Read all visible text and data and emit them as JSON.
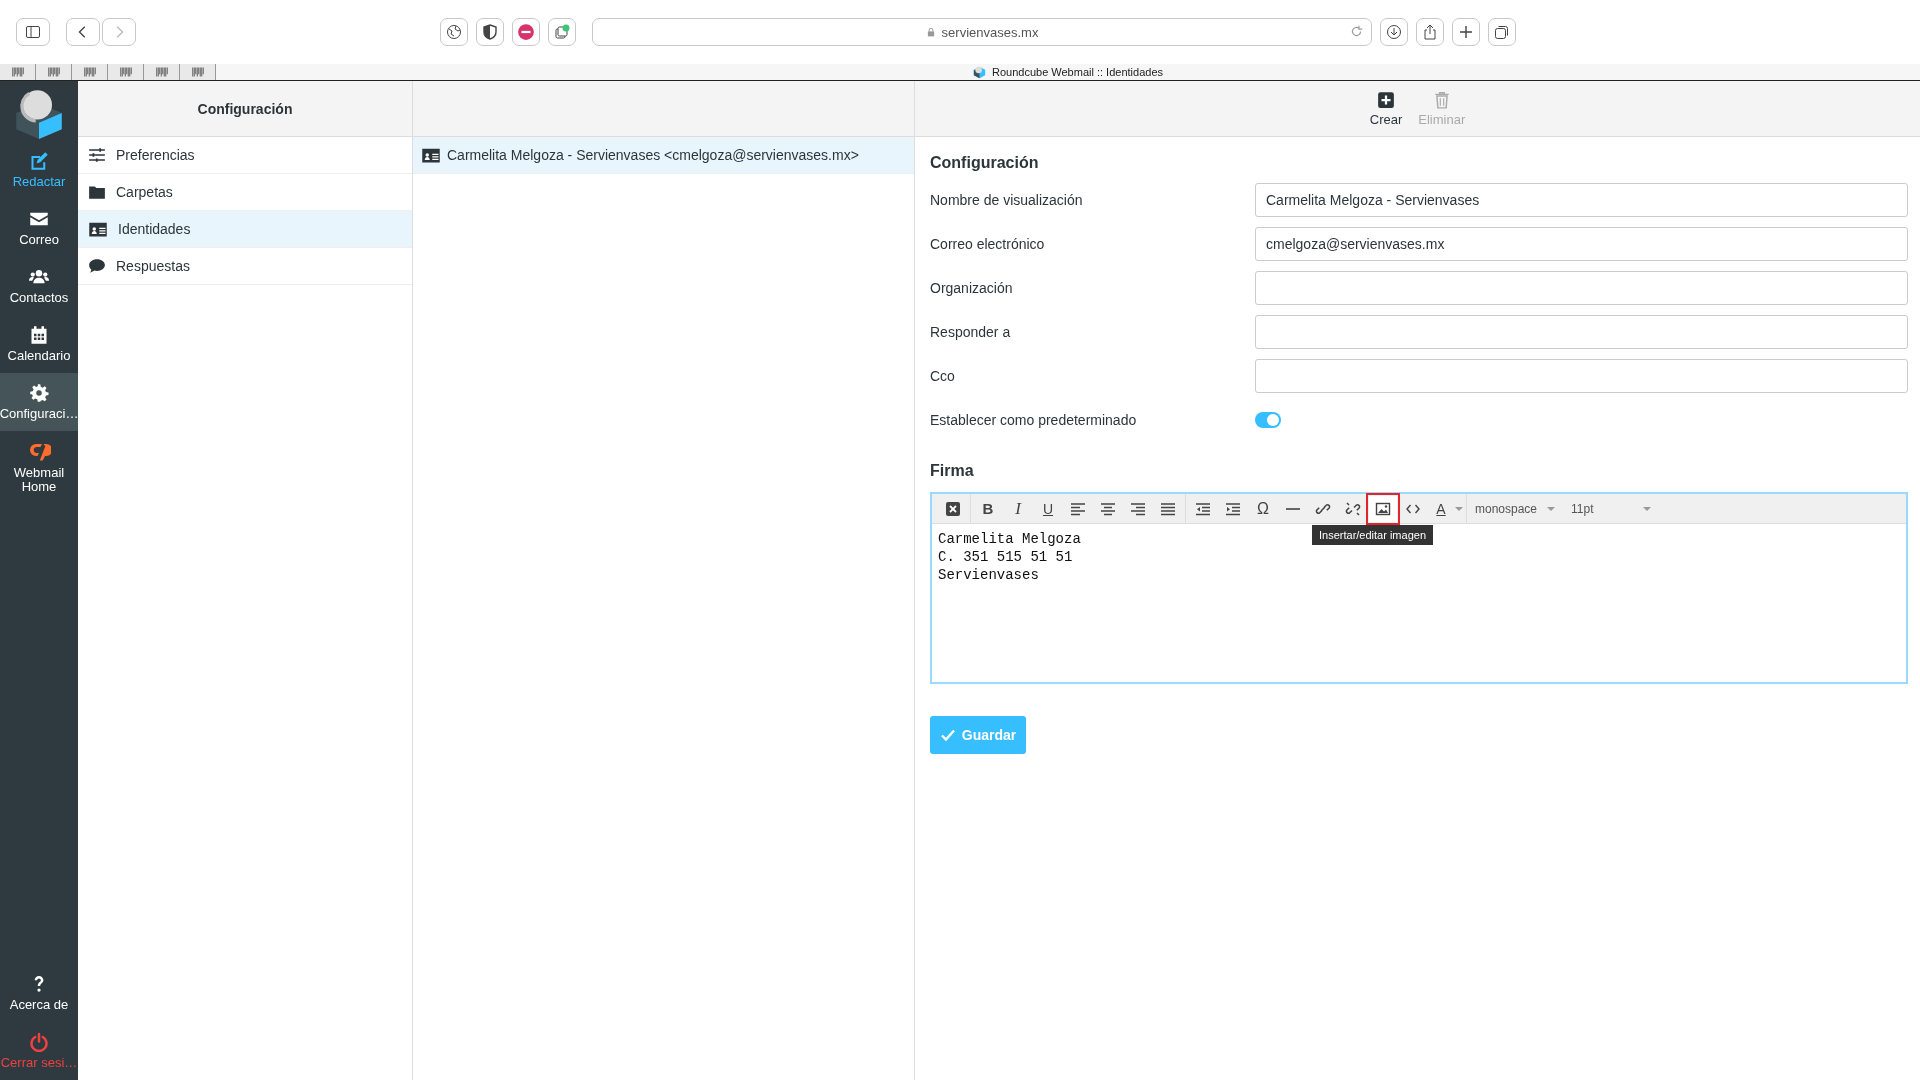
{
  "browser": {
    "address": "servienvases.mx",
    "back_disabled": false,
    "forward_disabled": true,
    "page_title": "Roundcube Webmail :: Identidades"
  },
  "nav": [
    {
      "kind": "compose",
      "label": "Redactar",
      "selected": false
    },
    {
      "kind": "mail",
      "label": "Correo",
      "selected": false
    },
    {
      "kind": "contacts",
      "label": "Contactos",
      "selected": false
    },
    {
      "kind": "calendar",
      "label": "Calendario",
      "selected": false
    },
    {
      "kind": "settings",
      "label": "Configuraci…",
      "selected": true
    },
    {
      "kind": "cpanel",
      "label": "Webmail Home",
      "selected": false
    }
  ],
  "nav_bottom": [
    {
      "kind": "about",
      "label": "Acerca de"
    },
    {
      "kind": "logout",
      "label": "Cerrar sesi…"
    }
  ],
  "settings": {
    "title": "Configuración",
    "items": [
      {
        "kind": "preferences",
        "label": "Preferencias",
        "selected": false
      },
      {
        "kind": "folders",
        "label": "Carpetas",
        "selected": false
      },
      {
        "kind": "identities",
        "label": "Identidades",
        "selected": true
      },
      {
        "kind": "responses",
        "label": "Respuestas",
        "selected": false
      }
    ]
  },
  "identities": [
    {
      "label": "Carmelita Melgoza - Servienvases <cmelgoza@servienvases.mx>",
      "selected": true
    }
  ],
  "actions": [
    {
      "kind": "create",
      "label": "Crear",
      "disabled": false
    },
    {
      "kind": "delete",
      "label": "Eliminar",
      "disabled": true
    }
  ],
  "form": {
    "title": "Configuración",
    "fields": [
      {
        "label": "Nombre de visualización",
        "value": "Carmelita Melgoza - Servienvases"
      },
      {
        "label": "Correo electrónico",
        "value": "cmelgoza@servienvases.mx"
      },
      {
        "label": "Organización"
      },
      {
        "label": "Responder a"
      },
      {
        "label": "Cco"
      }
    ],
    "default_toggle": {
      "label": "Establecer como predeterminado",
      "on": true
    }
  },
  "signature": {
    "title": "Firma",
    "tool_groups": [
      [
        {
          "kind": "clear",
          "highlighted": false
        }
      ],
      [
        {
          "kind": "bold",
          "label": "B",
          "highlighted": false
        },
        {
          "kind": "italic",
          "label": "I",
          "highlighted": false
        },
        {
          "kind": "underline",
          "label": "U",
          "highlighted": false
        },
        {
          "kind": "alignleft",
          "highlighted": false
        },
        {
          "kind": "aligncenter",
          "highlighted": false
        },
        {
          "kind": "alignright",
          "highlighted": false
        },
        {
          "kind": "justify",
          "highlighted": false
        }
      ],
      [
        {
          "kind": "outdent",
          "highlighted": false
        },
        {
          "kind": "indent",
          "highlighted": false
        },
        {
          "kind": "charmap",
          "label": "Ω",
          "highlighted": false
        },
        {
          "kind": "hr",
          "highlighted": false
        },
        {
          "kind": "link",
          "highlighted": false
        },
        {
          "kind": "unlink",
          "highlighted": false
        },
        {
          "kind": "image",
          "highlighted": true
        },
        {
          "kind": "code",
          "highlighted": false
        },
        {
          "kind": "forecolor",
          "label": "A",
          "highlighted": false
        }
      ]
    ],
    "font_family": "monospace",
    "font_size": "11pt",
    "tooltip": "Insertar/editar imagen",
    "lines": [
      "Carmelita Melgoza",
      "C. 351 515 51 51",
      "Servienvases"
    ]
  },
  "save_button": "Guardar"
}
